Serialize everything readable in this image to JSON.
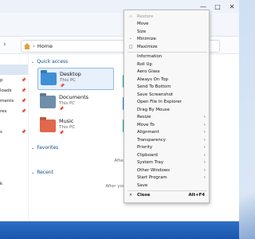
{
  "window": {
    "controls": [
      "—",
      "□",
      "✕"
    ]
  },
  "address": {
    "path": "Home",
    "nav_chevron": "›"
  },
  "sidebar": {
    "items": [
      {
        "label": "",
        "pinned": false,
        "selected": false
      },
      {
        "label": "",
        "pinned": false,
        "selected": true
      },
      {
        "label": "p",
        "pinned": true,
        "selected": false
      },
      {
        "label": "loads",
        "pinned": true,
        "selected": false
      },
      {
        "label": "ments",
        "pinned": true,
        "selected": false
      },
      {
        "label": "res",
        "pinned": true,
        "selected": false
      },
      {
        "label": "",
        "pinned": false,
        "selected": false
      },
      {
        "label": "s",
        "pinned": true,
        "selected": false
      },
      {
        "label": "",
        "pinned": false,
        "selected": false
      },
      {
        "label": "",
        "pinned": false,
        "selected": false
      },
      {
        "label": "",
        "pinned": false,
        "selected": false
      },
      {
        "label": "",
        "pinned": false,
        "selected": false
      },
      {
        "label": "k",
        "pinned": false,
        "selected": false
      }
    ],
    "pin_glyph": "📌"
  },
  "quick_access": {
    "heading": "Quick access",
    "tiles": [
      {
        "name": "Desktop",
        "sub": "This PC",
        "color": "#3f8fd6",
        "pinned": true,
        "selected": true
      },
      {
        "name": "Documents",
        "sub": "This PC",
        "color": "#6f8fa8",
        "pinned": true,
        "selected": false
      },
      {
        "name": "Music",
        "sub": "This PC",
        "color": "#e0684b",
        "pinned": true,
        "selected": false
      }
    ]
  },
  "favorites": {
    "heading": "Favorites",
    "empty_text": "After you've pinne"
  },
  "recent": {
    "heading": "Recent",
    "empty_text": "After you've opened some"
  },
  "context_menu": {
    "items": [
      {
        "icon": "▫",
        "label": "Restore",
        "disabled": true
      },
      {
        "icon": "",
        "label": "Move"
      },
      {
        "icon": "",
        "label": "Size"
      },
      {
        "icon": "–",
        "label": "Minimize"
      },
      {
        "icon": "□",
        "label": "Maximize"
      },
      {
        "sep": true
      },
      {
        "icon": "",
        "label": "Information"
      },
      {
        "icon": "",
        "label": "Roll Up"
      },
      {
        "icon": "",
        "label": "Aero Glass"
      },
      {
        "icon": "",
        "label": "Always On Top"
      },
      {
        "icon": "",
        "label": "Send To Bottom"
      },
      {
        "icon": "",
        "label": "Save Screenshot"
      },
      {
        "icon": "",
        "label": "Open File In Explorer"
      },
      {
        "icon": "",
        "label": "Drag By Mouse"
      },
      {
        "icon": "",
        "label": "Resize",
        "submenu": true
      },
      {
        "icon": "",
        "label": "Move To",
        "submenu": true
      },
      {
        "icon": "",
        "label": "Alignment",
        "submenu": true
      },
      {
        "icon": "",
        "label": "Transparency",
        "submenu": true
      },
      {
        "icon": "",
        "label": "Priority",
        "submenu": true
      },
      {
        "icon": "",
        "label": "Clipboard",
        "submenu": true
      },
      {
        "icon": "",
        "label": "System Tray",
        "submenu": true
      },
      {
        "icon": "",
        "label": "Other Windows",
        "submenu": true
      },
      {
        "icon": "",
        "label": "Start Program",
        "submenu": true
      },
      {
        "icon": "",
        "label": "Save"
      },
      {
        "sep": true
      },
      {
        "icon": "✕",
        "label": "Close",
        "shortcut": "Alt+F4",
        "bold": true
      }
    ],
    "submenu_glyph": "›"
  }
}
